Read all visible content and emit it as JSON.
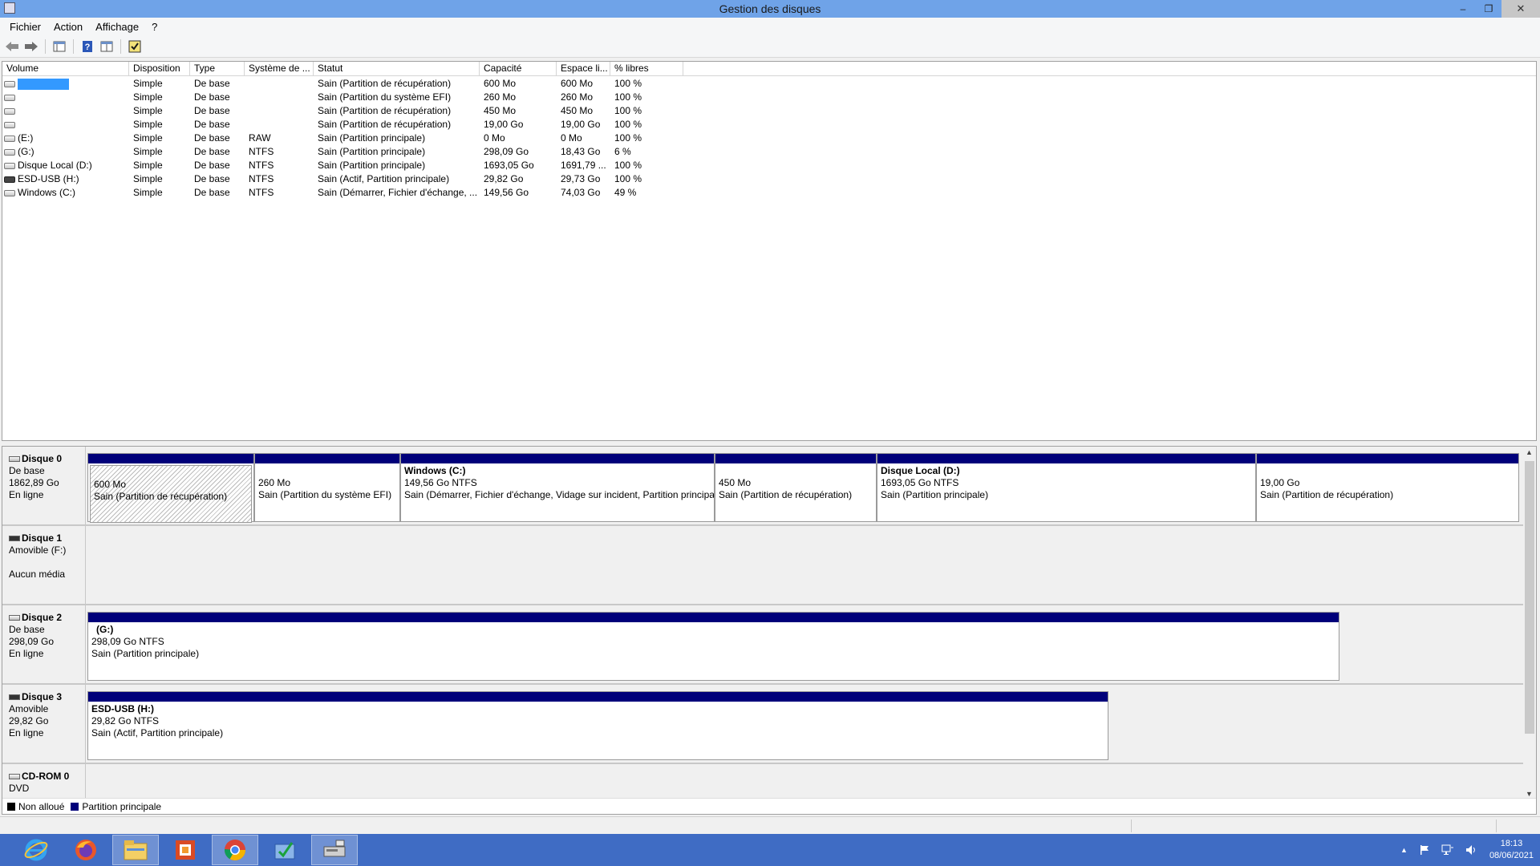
{
  "window": {
    "title": "Gestion des disques",
    "minimize_glyph": "‒",
    "restore_glyph": "❐",
    "close_glyph": "✕"
  },
  "menu": [
    "Fichier",
    "Action",
    "Affichage",
    "?"
  ],
  "volume_table": {
    "columns": [
      "Volume",
      "Disposition",
      "Type",
      "Système de ...",
      "Statut",
      "Capacité",
      "Espace li...",
      "% libres"
    ],
    "rows": [
      {
        "volume": "",
        "disposition": "Simple",
        "type": "De base",
        "fs": "",
        "status": "Sain (Partition de récupération)",
        "capacity": "600 Mo",
        "free": "600 Mo",
        "pct": "100 %"
      },
      {
        "volume": "",
        "disposition": "Simple",
        "type": "De base",
        "fs": "",
        "status": "Sain (Partition du système EFI)",
        "capacity": "260 Mo",
        "free": "260 Mo",
        "pct": "100 %"
      },
      {
        "volume": "",
        "disposition": "Simple",
        "type": "De base",
        "fs": "",
        "status": "Sain (Partition de récupération)",
        "capacity": "450 Mo",
        "free": "450 Mo",
        "pct": "100 %"
      },
      {
        "volume": "",
        "disposition": "Simple",
        "type": "De base",
        "fs": "",
        "status": "Sain (Partition de récupération)",
        "capacity": "19,00 Go",
        "free": "19,00 Go",
        "pct": "100 %"
      },
      {
        "volume": "(E:)",
        "disposition": "Simple",
        "type": "De base",
        "fs": "RAW",
        "status": "Sain (Partition principale)",
        "capacity": "0 Mo",
        "free": "0 Mo",
        "pct": "100 %"
      },
      {
        "volume": "(G:)",
        "disposition": "Simple",
        "type": "De base",
        "fs": "NTFS",
        "status": "Sain (Partition principale)",
        "capacity": "298,09 Go",
        "free": "18,43 Go",
        "pct": "6 %"
      },
      {
        "volume": "Disque Local  (D:)",
        "disposition": "Simple",
        "type": "De base",
        "fs": "NTFS",
        "status": "Sain (Partition principale)",
        "capacity": "1693,05 Go",
        "free": "1691,79 ...",
        "pct": "100 %"
      },
      {
        "volume": "ESD-USB (H:)",
        "disposition": "Simple",
        "type": "De base",
        "fs": "NTFS",
        "status": "Sain (Actif, Partition principale)",
        "capacity": "29,82 Go",
        "free": "29,73 Go",
        "pct": "100 %"
      },
      {
        "volume": "Windows (C:)",
        "disposition": "Simple",
        "type": "De base",
        "fs": "NTFS",
        "status": "Sain (Démarrer, Fichier d'échange, ...",
        "capacity": "149,56 Go",
        "free": "74,03 Go",
        "pct": "49 %"
      }
    ]
  },
  "disks": [
    {
      "name": "Disque 0",
      "line1": "De base",
      "line2": "1862,89 Go",
      "line3": "En ligne",
      "partitions": [
        {
          "name": "",
          "size": "600 Mo",
          "status": "Sain (Partition de récupération)"
        },
        {
          "name": "",
          "size": "260 Mo",
          "status": "Sain (Partition du système EFI)"
        },
        {
          "name": "Windows  (C:)",
          "size": "149,56 Go NTFS",
          "status": "Sain (Démarrer, Fichier d'échange, Vidage sur incident, Partition principale)"
        },
        {
          "name": "",
          "size": "450 Mo",
          "status": "Sain (Partition de récupération)"
        },
        {
          "name": "Disque Local   (D:)",
          "size": "1693,05 Go NTFS",
          "status": "Sain (Partition principale)"
        },
        {
          "name": "",
          "size": "19,00 Go",
          "status": "Sain (Partition de récupération)"
        }
      ]
    },
    {
      "name": "Disque 1",
      "line1": "Amovible (F:)",
      "line2": "",
      "line3": "Aucun média",
      "partitions": []
    },
    {
      "name": "Disque 2",
      "line1": "De base",
      "line2": "298,09 Go",
      "line3": "En ligne",
      "partitions": [
        {
          "name": "(G:)",
          "size": "298,09 Go NTFS",
          "status": "Sain (Partition principale)"
        }
      ]
    },
    {
      "name": "Disque 3",
      "line1": "Amovible",
      "line2": "29,82 Go",
      "line3": "En ligne",
      "partitions": [
        {
          "name": "ESD-USB  (H:)",
          "size": "29,82 Go NTFS",
          "status": "Sain (Actif, Partition principale)"
        }
      ]
    },
    {
      "name": "CD-ROM 0",
      "line1": "DVD",
      "line2": "",
      "line3": "",
      "partitions": []
    }
  ],
  "legend": [
    {
      "label": "Non alloué",
      "color": "#000000"
    },
    {
      "label": "Partition principale",
      "color": "#00007a"
    }
  ],
  "taskbar": {
    "apps": [
      "internet-explorer-icon",
      "firefox-icon",
      "file-explorer-icon",
      "office-icon",
      "chrome-icon",
      "task-icon",
      "disk-management-icon"
    ],
    "time": "18:13",
    "date": "08/06/2021"
  }
}
